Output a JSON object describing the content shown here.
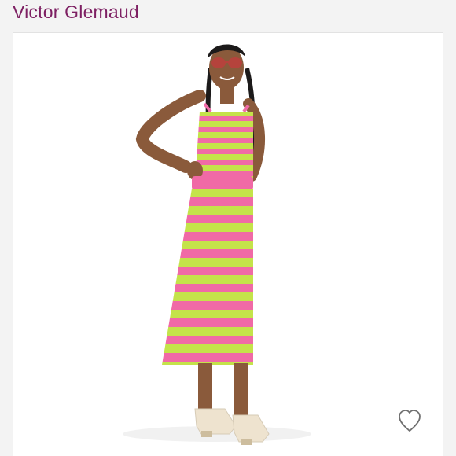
{
  "header": {
    "brand": "Victor Glemaud"
  },
  "product": {
    "image_icon": "model-photo",
    "colors": {
      "pink": "#f06aa6",
      "lime": "#c4e34a",
      "brand": "#7d1f62"
    }
  },
  "actions": {
    "like_icon": "heart-icon"
  }
}
